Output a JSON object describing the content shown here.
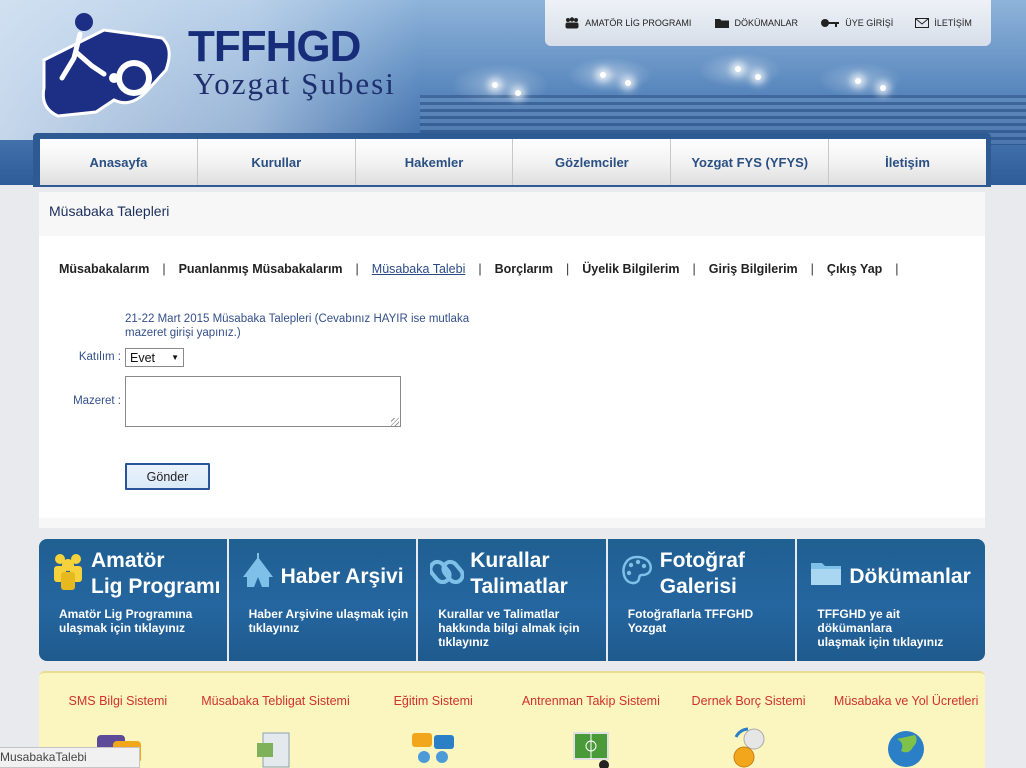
{
  "brand": {
    "title": "TFFHGD",
    "subtitle": "Yozgat Şubesi"
  },
  "toplinks": [
    {
      "label": "AMATÖR LİG PROGRAMI",
      "icon": "team-icon"
    },
    {
      "label": "DÖKÜMANLAR",
      "icon": "folder-icon"
    },
    {
      "label": "ÜYE GİRİŞİ",
      "icon": "key-icon"
    },
    {
      "label": "İLETİŞİM",
      "icon": "mail-icon"
    }
  ],
  "nav": [
    "Anasayfa",
    "Kurullar",
    "Hakemler",
    "Gözlemciler",
    "Yozgat FYS (YFYS)",
    "İletişim"
  ],
  "page": {
    "title": "Müsabaka Talepleri",
    "tabs": [
      "Müsabakalarım",
      "Puanlanmış Müsabakalarım",
      "Müsabaka Talebi",
      "Borçlarım",
      "Üyelik Bilgilerim",
      "Giriş Bilgilerim",
      "Çıkış Yap"
    ],
    "active_tab": "Müsabaka Talebi",
    "notice": "21-22 Mart 2015 Müsabaka Talepleri (Cevabınız HAYIR ise mutlaka mazeret girişi yapınız.)",
    "form": {
      "katilim_label": "Katılım :",
      "katilim_value": "Evet",
      "mazeret_label": "Mazeret :",
      "mazeret_value": "",
      "submit_label": "Gönder"
    }
  },
  "tiles": [
    {
      "title": "Amatör\nLig Programı",
      "desc": "Amatör Lig Programına\nulaşmak için tıklayınız",
      "icon": "team-icon"
    },
    {
      "title": "Haber Arşivi",
      "desc": "Haber Arşivine ulaşmak için\ntıklayınız",
      "icon": "tent-icon"
    },
    {
      "title": "Kurallar\nTalimatlar",
      "desc": "Kurallar ve Talimatlar\nhakkında bilgi almak için\ntıklayınız",
      "icon": "link-icon"
    },
    {
      "title": "Fotoğraf\nGalerisi",
      "desc": "Fotoğraflarla TFFGHD\nYozgat",
      "icon": "palette-icon"
    },
    {
      "title": "Dökümanlar",
      "desc": "TFFGHD ye ait dökümanlara\nulaşmak için tıklayınız",
      "icon": "folder-icon"
    }
  ],
  "services": [
    {
      "label": "SMS Bilgi Sistemi",
      "icon": "sms-icon"
    },
    {
      "label": "Müsabaka Tebligat Sistemi",
      "icon": "document-icon"
    },
    {
      "label": "Eğitim Sistemi",
      "icon": "users-chat-icon"
    },
    {
      "label": "Antrenman Takip Sistemi",
      "icon": "tactics-board-icon"
    },
    {
      "label": "Dernek Borç Sistemi",
      "icon": "coins-icon"
    },
    {
      "label": "Müsabaka ve Yol Ücretleri",
      "icon": "globe-icon"
    }
  ],
  "status_bar": "MusabakaTalebi",
  "colors": {
    "nav_text": "#2a4f82",
    "tile_bg": "#2566a0",
    "service_text": "#d0312d",
    "service_bg": "#fbf6bf"
  }
}
